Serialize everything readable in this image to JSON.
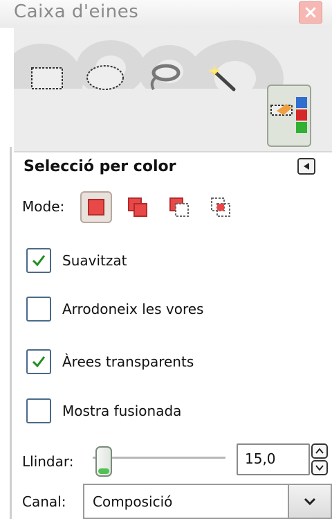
{
  "window": {
    "title": "Caixa d'eines"
  },
  "tools": [
    {
      "icon": "rect-select-icon"
    },
    {
      "icon": "ellipse-select-icon"
    },
    {
      "icon": "lasso-icon"
    },
    {
      "icon": "magic-wand-icon"
    },
    {
      "icon": "select-by-color-icon",
      "active": true
    }
  ],
  "panel": {
    "title": "Selecció per color",
    "mode": {
      "label": "Mode:",
      "selected": "replace"
    },
    "options": [
      {
        "label": "Suavitzat",
        "checked": true
      },
      {
        "label": "Arrodoneix les vores",
        "checked": false
      },
      {
        "label": "Àrees transparents",
        "checked": true
      },
      {
        "label": "Mostra fusionada",
        "checked": false
      }
    ],
    "threshold": {
      "label": "Llindar:",
      "value": "15,0",
      "slider_fraction": 0.08
    },
    "channel": {
      "label": "Canal:",
      "value": "Composició"
    }
  },
  "colors": {
    "accent": "#e84848",
    "check": "#1f8f1f",
    "highlight": "#52c152"
  }
}
